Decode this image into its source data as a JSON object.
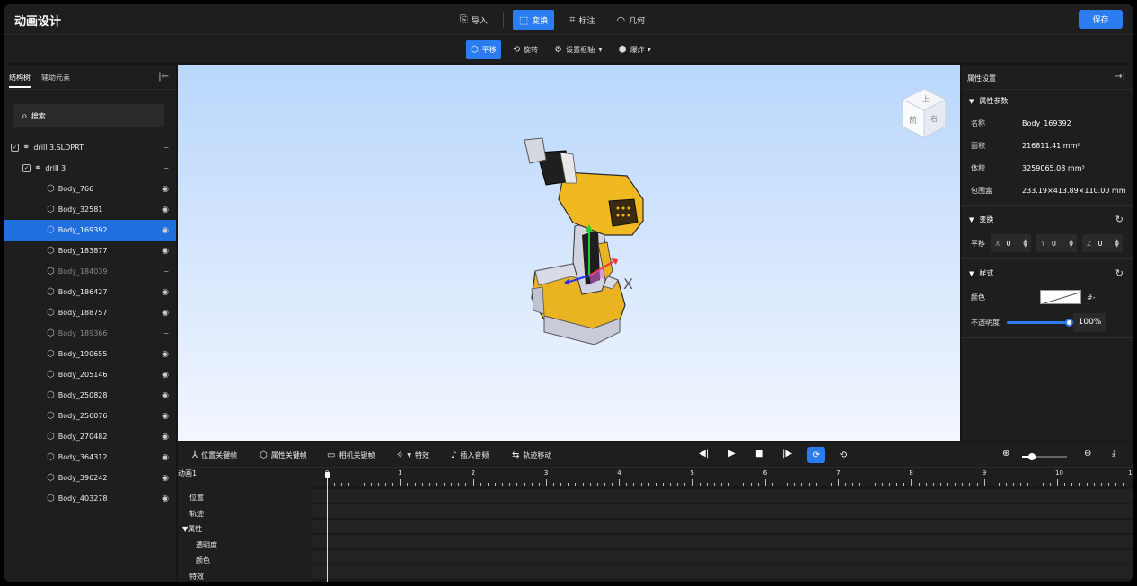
{
  "app": {
    "title": "动画设计",
    "save_label": "保存"
  },
  "modes": [
    {
      "label": "导入",
      "icon": "import-icon",
      "glyph": "⎘",
      "active": false
    },
    {
      "label": "变换",
      "icon": "transform-icon",
      "glyph": "⬚",
      "active": true
    },
    {
      "label": "标注",
      "icon": "annotate-icon",
      "glyph": "⌗",
      "active": false
    },
    {
      "label": "几何",
      "icon": "geometry-icon",
      "glyph": "◠",
      "active": false
    }
  ],
  "tools": [
    {
      "label": "平移",
      "icon": "move-icon",
      "glyph": "⬡",
      "active": true,
      "dropdown": false
    },
    {
      "label": "旋转",
      "icon": "rotate-icon",
      "glyph": "⟲",
      "active": false,
      "dropdown": false
    },
    {
      "label": "设置枢轴",
      "icon": "pivot-icon",
      "glyph": "⚙",
      "active": false,
      "dropdown": true
    },
    {
      "label": "爆炸",
      "icon": "explode-icon",
      "glyph": "⬢",
      "active": false,
      "dropdown": true
    }
  ],
  "left": {
    "tabs": [
      "结构树",
      "辅助元素"
    ],
    "search_placeholder": "搜索",
    "tree": [
      {
        "label": "drill 3.SLDPRT",
        "level": 0,
        "type": "root",
        "visible": false,
        "dim": false,
        "selected": false
      },
      {
        "label": "drill 3",
        "level": 1,
        "type": "group",
        "visible": false,
        "dim": false,
        "selected": false
      },
      {
        "label": "Body_766",
        "level": 2,
        "type": "body",
        "visible": true,
        "dim": false,
        "selected": false
      },
      {
        "label": "Body_32581",
        "level": 2,
        "type": "body",
        "visible": true,
        "dim": false,
        "selected": false
      },
      {
        "label": "Body_169392",
        "level": 2,
        "type": "body",
        "visible": true,
        "dim": false,
        "selected": true
      },
      {
        "label": "Body_183877",
        "level": 2,
        "type": "body",
        "visible": true,
        "dim": false,
        "selected": false
      },
      {
        "label": "Body_184039",
        "level": 2,
        "type": "body",
        "visible": false,
        "dim": true,
        "selected": false
      },
      {
        "label": "Body_186427",
        "level": 2,
        "type": "body",
        "visible": true,
        "dim": false,
        "selected": false
      },
      {
        "label": "Body_188757",
        "level": 2,
        "type": "body",
        "visible": true,
        "dim": false,
        "selected": false
      },
      {
        "label": "Body_189366",
        "level": 2,
        "type": "body",
        "visible": false,
        "dim": true,
        "selected": false
      },
      {
        "label": "Body_190655",
        "level": 2,
        "type": "body",
        "visible": true,
        "dim": false,
        "selected": false
      },
      {
        "label": "Body_205146",
        "level": 2,
        "type": "body",
        "visible": true,
        "dim": false,
        "selected": false
      },
      {
        "label": "Body_250828",
        "level": 2,
        "type": "body",
        "visible": true,
        "dim": false,
        "selected": false
      },
      {
        "label": "Body_256076",
        "level": 2,
        "type": "body",
        "visible": true,
        "dim": false,
        "selected": false
      },
      {
        "label": "Body_270482",
        "level": 2,
        "type": "body",
        "visible": true,
        "dim": false,
        "selected": false
      },
      {
        "label": "Body_364312",
        "level": 2,
        "type": "body",
        "visible": true,
        "dim": false,
        "selected": false
      },
      {
        "label": "Body_396242",
        "level": 2,
        "type": "body",
        "visible": true,
        "dim": false,
        "selected": false
      },
      {
        "label": "Body_403278",
        "level": 2,
        "type": "body",
        "visible": true,
        "dim": false,
        "selected": false
      }
    ]
  },
  "viewport": {
    "navcube": {
      "top": "上",
      "front": "前",
      "right": "右"
    },
    "axis_label": "X"
  },
  "right": {
    "title": "属性设置",
    "props_section": "属性参数",
    "props": [
      {
        "key": "名称",
        "value": "Body_169392"
      },
      {
        "key": "面积",
        "value": "216811.41 mm²"
      },
      {
        "key": "体积",
        "value": "3259065.08 mm³"
      },
      {
        "key": "包围盒",
        "value": "233.19×413.89×110.00 mm"
      }
    ],
    "transform_section": "变换",
    "translate_label": "平移",
    "translate": [
      {
        "axis": "X",
        "value": "0"
      },
      {
        "axis": "Y",
        "value": "0"
      },
      {
        "axis": "Z",
        "value": "0"
      }
    ],
    "style_section": "样式",
    "color_label": "颜色",
    "color_value": "#-",
    "opacity_label": "不透明度",
    "opacity_value": "100%",
    "opacity_fraction": 1.0
  },
  "timeline": {
    "tools": [
      {
        "label": "位置关键帧",
        "icon": "position-keyframe-icon",
        "glyph": "⅄"
      },
      {
        "label": "属性关键帧",
        "icon": "property-keyframe-icon",
        "glyph": "⬡"
      },
      {
        "label": "相机关键帧",
        "icon": "camera-keyframe-icon",
        "glyph": "▭"
      },
      {
        "label": "特效",
        "icon": "effects-icon",
        "glyph": "✧"
      },
      {
        "label": "插入音频",
        "icon": "audio-icon",
        "glyph": "♪"
      },
      {
        "label": "轨迹移动",
        "icon": "path-move-icon",
        "glyph": "⇆"
      }
    ],
    "animation_name": "动画1",
    "tracks": [
      "位置",
      "轨迹",
      "属性",
      "透明度",
      "颜色",
      "特效"
    ],
    "ruler_labels": [
      "0",
      "1",
      "2",
      "3",
      "4",
      "5",
      "6",
      "7",
      "8",
      "9",
      "10",
      "1"
    ],
    "zoom_fraction": 0.2
  }
}
